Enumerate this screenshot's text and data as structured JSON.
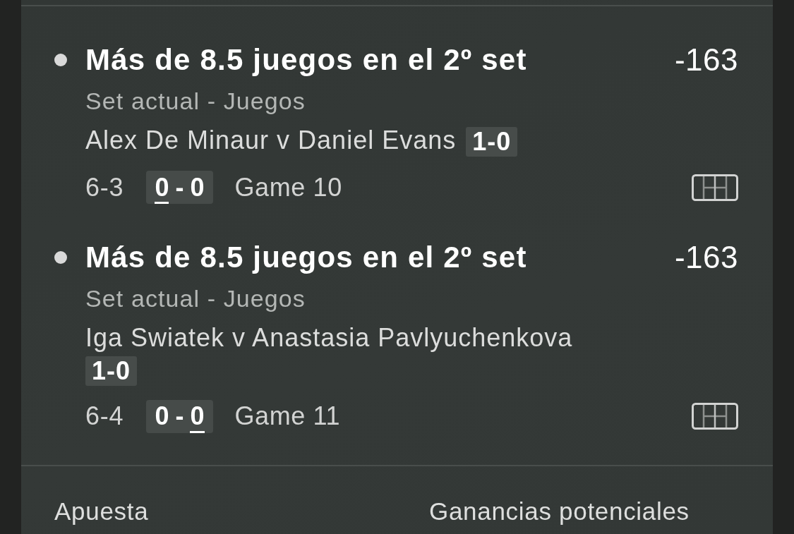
{
  "selections": [
    {
      "title": "Más de 8.5 juegos en el 2º set",
      "odds": "-163",
      "market": "Set actual - Juegos",
      "event": "Alex De Minaur v Daniel Evans",
      "sets_score": "1-0",
      "current_set_games": "6-3",
      "points": [
        {
          "value": "0",
          "serving": true
        },
        {
          "value": "0",
          "serving": false
        }
      ],
      "points_separator": "-",
      "game": "Game 10"
    },
    {
      "title": "Más de 8.5 juegos en el 2º set",
      "odds": "-163",
      "market": "Set actual - Juegos",
      "event": "Iga Swiatek v Anastasia Pavlyuchenkova",
      "sets_score": "1-0",
      "current_set_games": "6-4",
      "points": [
        {
          "value": "0",
          "serving": false
        },
        {
          "value": "0",
          "serving": true
        }
      ],
      "points_separator": "-",
      "game": "Game 11"
    }
  ],
  "footer": {
    "columns": [
      "Apuesta",
      "Ganancias potenciales"
    ]
  }
}
